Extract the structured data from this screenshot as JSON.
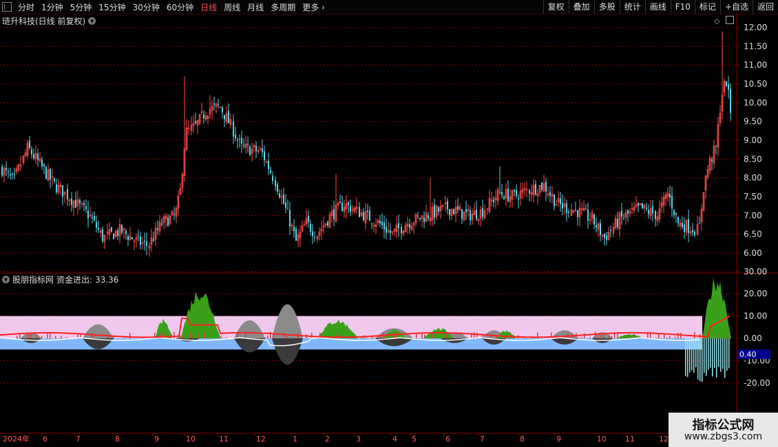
{
  "toolbar": {
    "periods": [
      "分时",
      "1分钟",
      "5分钟",
      "15分钟",
      "30分钟",
      "60分钟",
      "日线",
      "周线",
      "月线",
      "多周期",
      "更多"
    ],
    "active_period": "日线",
    "right_buttons": [
      "复权",
      "叠加",
      "多股",
      "统计",
      "画线",
      "F10",
      "标记",
      "+自选",
      "返回"
    ]
  },
  "main_chart": {
    "title": "琏升科技(日线 前复权)",
    "price_ticks": [
      "12.00",
      "11.50",
      "11.00",
      "10.50",
      "10.00",
      "9.50",
      "9.00",
      "8.50",
      "8.00",
      "7.50",
      "7.00",
      "6.50",
      "6.00"
    ]
  },
  "indicator": {
    "source": "股朋指标网",
    "name": "资金进出:",
    "value": "33.36",
    "ticks": [
      "30.00",
      "20.00",
      "10.00",
      "0.00",
      "-10.00",
      "-20.00"
    ],
    "current_value_label": "0.40"
  },
  "time_axis": {
    "labels": [
      "2024年",
      "6",
      "7",
      "8",
      "9",
      "10",
      "11",
      "12",
      "1",
      "2",
      "3",
      "4",
      "5",
      "6",
      "7",
      "8",
      "9",
      "10",
      "11",
      "12"
    ]
  },
  "watermark": {
    "line1": "指标公式网",
    "line2": "www.zbgs3.com"
  },
  "colors": {
    "up": "#ff4d4d",
    "down": "#5bd6e6",
    "grid": "#8a0000",
    "active": "#ff4a4a",
    "pink_band": "#f0c8ee",
    "blue_band": "#7fb8ff",
    "green": "#3aa01a",
    "grey": "#8a8a8a"
  }
}
